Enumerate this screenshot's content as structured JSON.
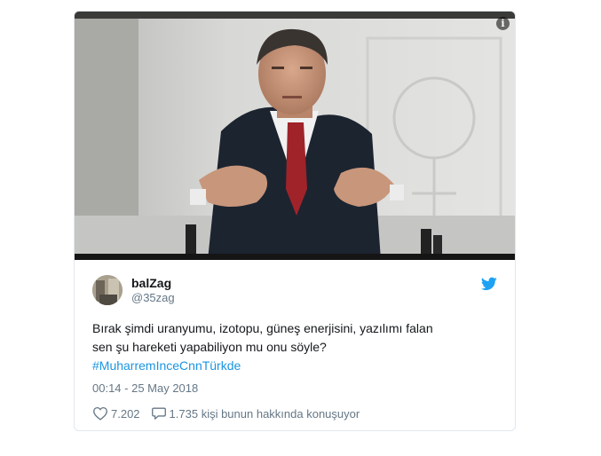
{
  "media": {
    "alt_icon": "info-icon",
    "photo_icon": "speaker-photo"
  },
  "author": {
    "display_name": "balZag",
    "handle": "@35zag",
    "avatar_icon": "avatar"
  },
  "tweet": {
    "line1": "Bırak şimdi uranyumu, izotopu, güneş enerjisini, yazılımı falan",
    "line2": "sen şu hareketi yapabiliyon mu onu söyle?",
    "hashtag": "#MuharremInceCnnTürkde",
    "timestamp": "00:14 - 25 May 2018"
  },
  "actions": {
    "likes": "7.202",
    "replies_text": "1.735 kişi bunun hakkında konuşuyor"
  },
  "colors": {
    "link": "#1b95e0",
    "secondary_text": "#657786",
    "twitter_blue": "#1da1f2"
  }
}
